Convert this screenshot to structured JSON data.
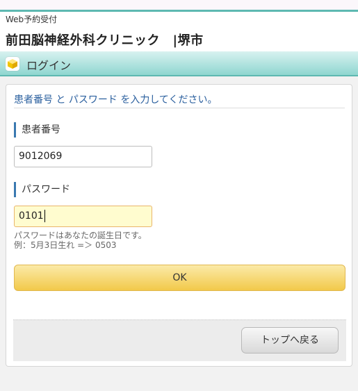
{
  "header": {
    "sub_title": "Web予約受付",
    "clinic_name": "前田脳神経外科クリニック　|堺市"
  },
  "section": {
    "title": "ログイン",
    "icon": "cube-icon",
    "accent_color": "#5db9b1"
  },
  "form": {
    "instruction": "患者番号 と パスワード を入力してください。",
    "patient_number_label": "患者番号",
    "patient_number_value": "9012069",
    "password_label": "パスワード",
    "password_value": "0101",
    "hint_line1": "パスワードはあなたの誕生日です。",
    "hint_line2": "例：5月3日生れ =＞ 0503",
    "ok_label": "OK"
  },
  "footer": {
    "back_label": "トップへ戻る"
  }
}
